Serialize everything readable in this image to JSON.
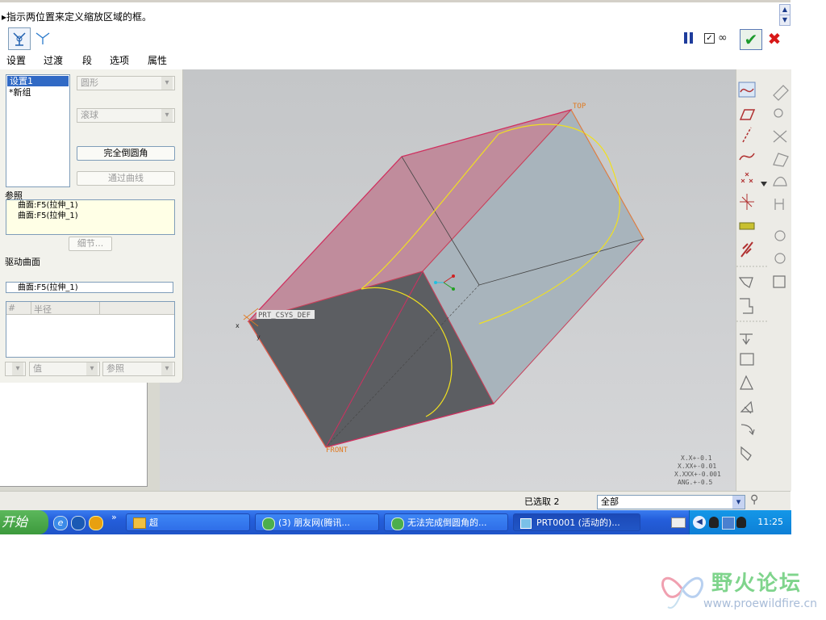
{
  "message": {
    "text": "指示两位置来定义缩放区域的框。"
  },
  "dashboard": {
    "tabs": [
      "设置",
      "过渡",
      "段",
      "选项",
      "属性"
    ]
  },
  "panel": {
    "sets": [
      "设置1",
      "*新组"
    ],
    "shape_select": "圆形",
    "method_select": "滚球",
    "full_round_button": "完全倒圆角",
    "through_curve_button": "通过曲线",
    "references_label": "参照",
    "references": [
      "曲面:F5(拉伸_1)",
      "曲面:F5(拉伸_1)"
    ],
    "details_button": "细节...",
    "driver_label": "驱动曲面",
    "driver_value": "曲面:F5(拉伸_1)",
    "table_headers": [
      "#",
      "半径"
    ],
    "value_select": "值",
    "ref_select": "参照"
  },
  "viewport": {
    "datum_top": "TOP",
    "datum_front": "FRONT",
    "csys_label": "PRT_CSYS_DEF",
    "axis_x": "x",
    "axis_y": "y",
    "tolerances": [
      "X.X+-0.1",
      "X.XX+-0.01",
      "X.XXX+-0.001",
      "ANG.+-0.5"
    ]
  },
  "status": {
    "selected": "已选取 2",
    "filter": "全部"
  },
  "taskbar": {
    "start": "开始",
    "quick_label": "»",
    "folder_task": "超",
    "tasks": [
      "(3) 朋友网(腾讯...",
      "无法完成倒圆角的...",
      "PRT0001 (活动的)..."
    ],
    "clock": "11:25"
  },
  "watermark": {
    "title": "野火论坛",
    "url": "www.proewildfire.cn"
  },
  "colors": {
    "taskbar": "#245edb",
    "viewport": "#c8c9cb",
    "ok_green": "#1c9a2c",
    "cancel_red": "#d81818",
    "pink_face": "#c08c9c",
    "dark_face": "#5c5e62",
    "light_face": "#a8b4bc",
    "round_edge": "#f0e020"
  }
}
